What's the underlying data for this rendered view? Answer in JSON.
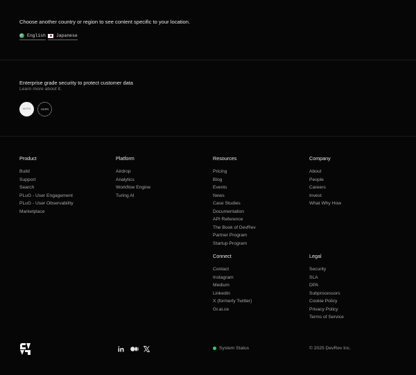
{
  "region": {
    "prompt": "Choose another country or region to see content specific to your location.",
    "languages": [
      {
        "label": "English",
        "icon": "globe-icon"
      },
      {
        "label": "Japanese",
        "icon": "japan-flag-icon"
      }
    ]
  },
  "security": {
    "title": "Enterprise grade security to protect customer data",
    "link": "Learn more about it.",
    "badges": {
      "aicpa_top": "AICPA",
      "aicpa_soc": "SOC",
      "gdpr": "GDPR"
    }
  },
  "columns": {
    "product": {
      "title": "Product",
      "items": [
        "Build",
        "Support",
        "Search",
        "PLuG - User Engagement",
        "PLuG - User Observability",
        "Marketplace"
      ]
    },
    "platform": {
      "title": "Platform",
      "items": [
        "Airdrop",
        "Analytics",
        "Workflow Engine",
        "Turing AI"
      ]
    },
    "resources": {
      "title": "Resources",
      "items": [
        "Pricing",
        "Blog",
        "Events",
        "News",
        "Case Studies",
        "Documentation",
        "API Reference",
        "The Book of DevRev",
        "Partner Program",
        "Startup Program"
      ]
    },
    "company": {
      "title": "Company",
      "items": [
        "About",
        "People",
        "Careers",
        "Invest",
        "What Why How"
      ]
    },
    "connect": {
      "title": "Connect",
      "items": [
        "Contact",
        "Instagram",
        "Medium",
        "Linkedin",
        "X (formerly Twitter)",
        "Gr.ai.ce"
      ]
    },
    "legal": {
      "title": "Legal",
      "items": [
        "Security",
        "SLA",
        "DPA",
        "Subprocessors",
        "Cookie Policy",
        "Privacy Policy",
        "Terms of Service"
      ]
    }
  },
  "bottom": {
    "social_icons": [
      "linkedin-icon",
      "medium-icon",
      "x-icon"
    ],
    "status": "System Status",
    "copyright": "© 2025 DevRev Inc.",
    "status_color": "#2ecc71"
  }
}
